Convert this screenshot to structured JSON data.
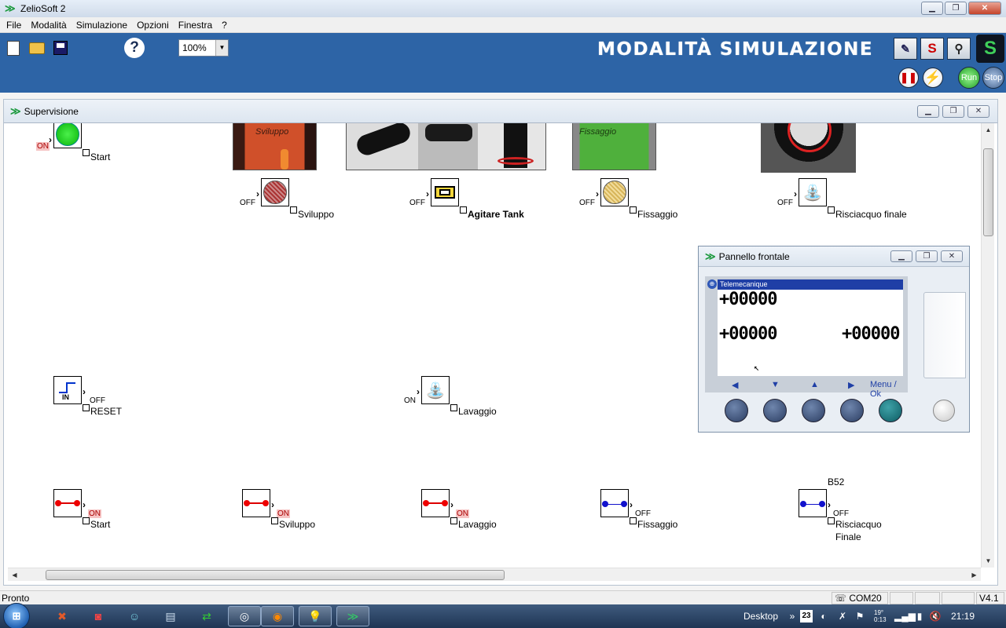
{
  "window": {
    "title": "ZelioSoft 2"
  },
  "menu": [
    "File",
    "Modalità",
    "Simulazione",
    "Opzioni",
    "Finestra",
    "?"
  ],
  "toolbar": {
    "help_label": "?",
    "zoom": "100%",
    "mode_title": "MODALITÀ SIMULAZIONE",
    "s_label": "S",
    "run_label": "Run",
    "stop_label": "Stop"
  },
  "supervision": {
    "title": "Supervisione",
    "start_lamp": {
      "state": "ON",
      "label": "Start"
    },
    "outputs": [
      {
        "state": "OFF",
        "label": "Sviluppo"
      },
      {
        "state": "OFF",
        "label": "Agitare Tank"
      },
      {
        "state": "OFF",
        "label": "Fissaggio"
      },
      {
        "state": "OFF",
        "label": "Risciacquo finale"
      }
    ],
    "photo_texts": {
      "sviluppo": "Sviluppo",
      "fissaggio": "Fissaggio"
    },
    "reset": {
      "icon_text": "IN",
      "state": "OFF",
      "label": "RESET"
    },
    "lavaggio_valve": {
      "state": "ON",
      "label": "Lavaggio"
    },
    "inputs": [
      {
        "state": "ON",
        "label": "Start"
      },
      {
        "state": "ON",
        "label": "Sviluppo"
      },
      {
        "state": "ON",
        "label": "Lavaggio"
      },
      {
        "state": "OFF",
        "label": "Fissaggio"
      },
      {
        "state": "OFF",
        "label": "Risciacquo",
        "label2": "Finale",
        "tag": "B52"
      }
    ]
  },
  "front_panel": {
    "title": "Pannello frontale",
    "brand": "Telemecanique",
    "values": [
      "+00000",
      "+00000",
      "+00000"
    ],
    "menu_ok": "Menu / Ok"
  },
  "statusbar": {
    "text": "Pronto",
    "port": "COM20",
    "version": "V4.1"
  },
  "taskbar": {
    "desktop": "Desktop",
    "date_day": "23",
    "temp": "19°",
    "temp2": "0:13",
    "clock": "21:19"
  }
}
